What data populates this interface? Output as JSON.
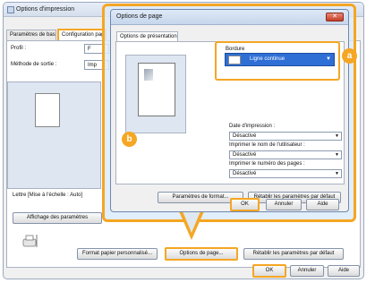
{
  "back_window": {
    "title": "Options d'impression",
    "tabs": [
      "Paramètres de bas",
      "Configuration page"
    ],
    "profile_label": "Profil :",
    "output_label": "Méthode de sortie :",
    "output_value": "Imp",
    "profile_value": "F",
    "scale_text": "Lettre [Mise à l'échelle : Auto]",
    "show_settings_button": "Affichage des paramètres",
    "custom_paper_button": "Format papier personnalisé...",
    "page_options_button": "Options de page...",
    "restore_defaults_button": "Rétablir les paramètres par défaut",
    "ok_button": "OK",
    "cancel_button": "Annuler",
    "help_button": "Aide"
  },
  "dialog": {
    "title": "Options de page",
    "close_glyph": "✕",
    "tab": "Options de présentation",
    "border_label": "Bordure",
    "border_value": "Ligne continue",
    "print_date_label": "Date d'impression :",
    "print_date_value": "Désactivé",
    "print_user_label": "Imprimer le nom de l'utilisateur :",
    "print_user_value": "Désactivé",
    "print_pagenum_label": "Imprimer le numéro des pages :",
    "print_pagenum_value": "Désactivé",
    "format_params_button": "Paramètres de format...",
    "restore_defaults_button": "Rétablir les paramètres par défaut",
    "ok_button": "OK",
    "cancel_button": "Annuler",
    "help_button": "Aide"
  },
  "markers": {
    "a": "a",
    "b": "b"
  },
  "colors": {
    "highlight": "#f5a623",
    "selection": "#2e6fd6"
  }
}
